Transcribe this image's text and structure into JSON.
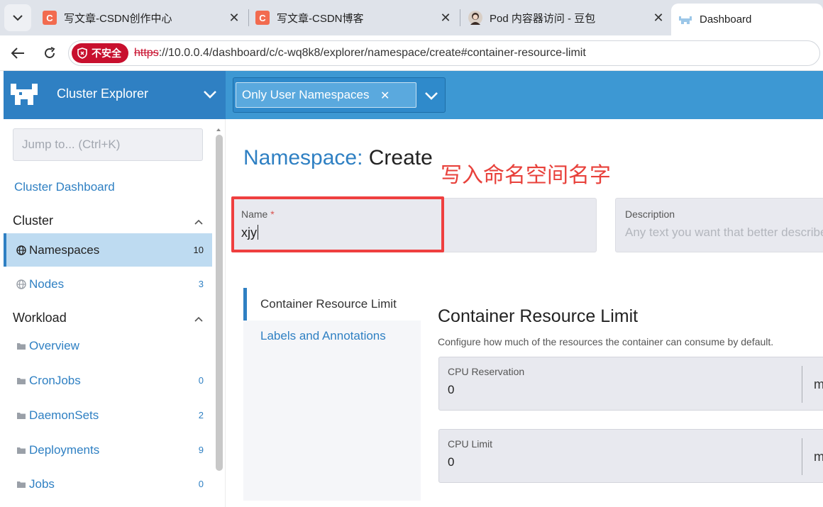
{
  "browser": {
    "tabs": [
      {
        "title": "写文章-CSDN创作中心",
        "favicon": "csdn-c",
        "active": false
      },
      {
        "title": "写文章-CSDN博客",
        "favicon": "csdn-c",
        "active": false
      },
      {
        "title": "Pod 内容器访问 - 豆包",
        "favicon": "doubao-avatar",
        "active": false
      },
      {
        "title": "Dashboard",
        "favicon": "rancher-logo",
        "active": true
      }
    ],
    "security_label": "不安全",
    "url_scheme": "https",
    "url_rest": "://10.0.0.4/dashboard/c/c-wq8k8/explorer/namespace/create#container-resource-limit"
  },
  "header": {
    "cluster_title": "Cluster Explorer",
    "namespace_filter": "Only User Namespaces",
    "brand_color": "#2f80c3"
  },
  "sidebar": {
    "jump_placeholder": "Jump to... (Ctrl+K)",
    "dashboard_link": "Cluster Dashboard",
    "groups": [
      {
        "title": "Cluster",
        "items": [
          {
            "label": "Namespaces",
            "count": "10",
            "active": true,
            "icon": "globe-icon"
          },
          {
            "label": "Nodes",
            "count": "3",
            "active": false,
            "icon": "globe-icon"
          }
        ]
      },
      {
        "title": "Workload",
        "items": [
          {
            "label": "Overview",
            "count": "",
            "icon": "folder-icon"
          },
          {
            "label": "CronJobs",
            "count": "0",
            "icon": "folder-icon"
          },
          {
            "label": "DaemonSets",
            "count": "2",
            "icon": "folder-icon"
          },
          {
            "label": "Deployments",
            "count": "9",
            "icon": "folder-icon"
          },
          {
            "label": "Jobs",
            "count": "0",
            "icon": "folder-icon"
          }
        ]
      }
    ]
  },
  "main": {
    "title_kind": "Namespace:",
    "title_action": "Create",
    "annotation": "写入命名空间名字",
    "name_label": "Name",
    "name_required": "*",
    "name_value": "xjy",
    "description_label": "Description",
    "description_placeholder": "Any text you want that better describes this resource",
    "tabs": [
      "Container Resource Limit",
      "Labels and Annotations"
    ],
    "section_title": "Container Resource Limit",
    "section_desc": "Configure how much of the resources the container can consume by default.",
    "fields": [
      {
        "label": "CPU Reservation",
        "value": "0",
        "unit": "m"
      },
      {
        "label": "CPU Limit",
        "value": "0",
        "unit": "m"
      }
    ]
  }
}
